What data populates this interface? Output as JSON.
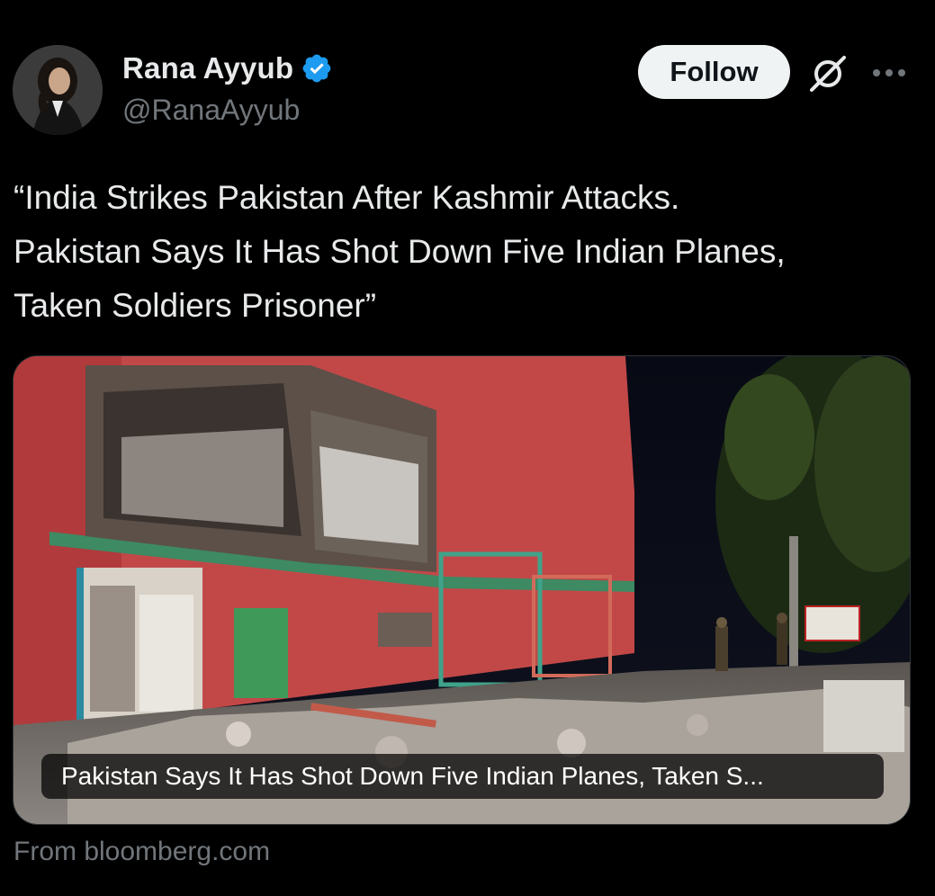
{
  "author": {
    "display_name": "Rana Ayyub",
    "handle": "@RanaAyyub",
    "verified": true
  },
  "actions": {
    "follow_label": "Follow",
    "grok_icon": "grok-icon",
    "more_icon": "more-dots-icon"
  },
  "tweet": {
    "lines": [
      "“India Strikes Pakistan After Kashmir Attacks.",
      "Pakistan Says It Has Shot Down Five Indian Planes,",
      "Taken Soldiers Prisoner”"
    ]
  },
  "link_card": {
    "caption": "Pakistan Says It Has Shot Down Five Indian Planes, Taken S...",
    "source": "From bloomberg.com",
    "image_description_icon": "damaged-building-photo"
  },
  "colors": {
    "background": "#000000",
    "text_primary": "#e7e9ea",
    "text_secondary": "#71767b",
    "verified_blue": "#1d9bf0",
    "follow_bg": "#eff3f4"
  }
}
